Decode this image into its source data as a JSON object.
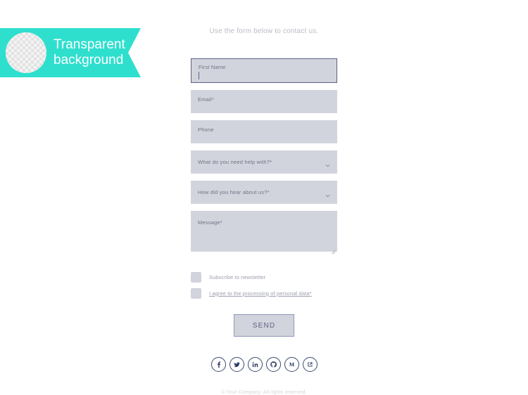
{
  "badge": {
    "text": "Transparent\nbackground",
    "accent_color": "#2fdfce",
    "circle_icon": "transparency-checker-circle"
  },
  "form": {
    "intro": "Use the form below to contact us.",
    "fields": [
      {
        "name": "first-name",
        "label": "First Name",
        "value": "",
        "type": "text",
        "focused": true
      },
      {
        "name": "email",
        "label": "Email*",
        "value": "",
        "type": "text",
        "focused": false
      },
      {
        "name": "phone",
        "label": "Phone",
        "value": "",
        "type": "text",
        "focused": false
      },
      {
        "name": "help-topic",
        "label": "What do you need help with?*",
        "value": "",
        "type": "select",
        "focused": false
      },
      {
        "name": "referral-source",
        "label": "How did you hear about us?*",
        "value": "",
        "type": "select",
        "focused": false
      },
      {
        "name": "message",
        "label": "Message*",
        "value": "",
        "type": "textarea",
        "focused": false
      }
    ],
    "checkboxes": [
      {
        "name": "newsletter",
        "label": "Subscribe to newsletter",
        "checked": false,
        "link": false
      },
      {
        "name": "privacy-consent",
        "label": "I agree to the processing of personal data*",
        "checked": false,
        "link": true
      }
    ],
    "submit_label": "SEND",
    "field_bg": "#d2d4dd",
    "focus_border": "#5c6183"
  },
  "social": [
    {
      "name": "facebook",
      "icon": "facebook-icon"
    },
    {
      "name": "twitter",
      "icon": "twitter-icon"
    },
    {
      "name": "linkedin",
      "icon": "linkedin-icon"
    },
    {
      "name": "github",
      "icon": "github-icon"
    },
    {
      "name": "medium",
      "icon": "medium-icon"
    },
    {
      "name": "external-link",
      "icon": "external-link-icon"
    }
  ],
  "footer": {
    "copyright": "© Your Company. All rights reserved."
  }
}
